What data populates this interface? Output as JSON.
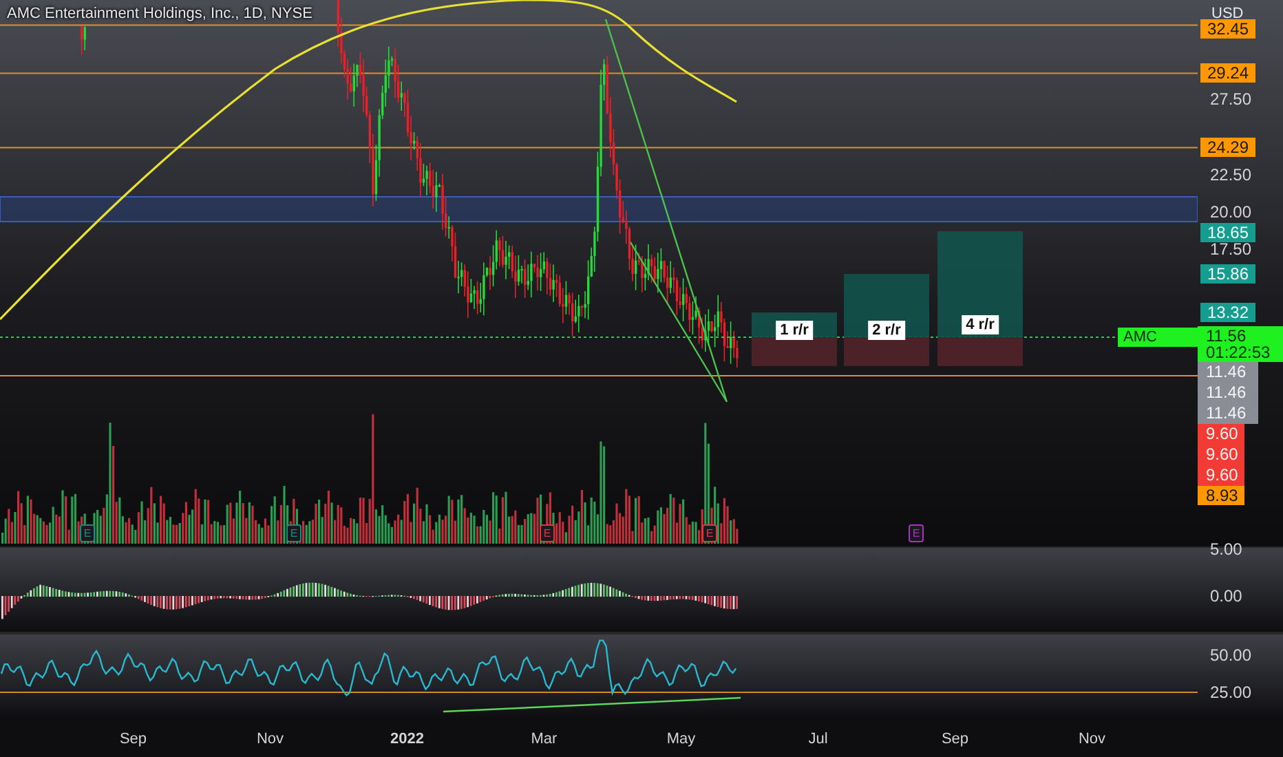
{
  "header": {
    "title": "AMC Entertainment Holdings, Inc., 1D, NYSE",
    "currency": "USD"
  },
  "price_axis": {
    "ticks": [
      "27.50",
      "22.50",
      "20.00",
      "17.50"
    ]
  },
  "price_tags": [
    {
      "text": "32.45",
      "color": "#ff9800"
    },
    {
      "text": "29.24",
      "color": "#ff9800"
    },
    {
      "text": "24.29",
      "color": "#ff9800"
    },
    {
      "text": "18.65",
      "color": "#159d8f"
    },
    {
      "text": "15.86",
      "color": "#159d8f"
    },
    {
      "text": "13.32",
      "color": "#159d8f"
    }
  ],
  "last_price": {
    "symbol": "AMC",
    "price": "11.56",
    "countdown": "01:22:53"
  },
  "stacked_tags": [
    {
      "text": "11.46",
      "color": "#8a8d96"
    },
    {
      "text": "11.46",
      "color": "#8a8d96"
    },
    {
      "text": "11.46",
      "color": "#8a8d96"
    },
    {
      "text": "9.60",
      "color": "#f23b34"
    },
    {
      "text": "9.60",
      "color": "#f23b34"
    },
    {
      "text": "9.60",
      "color": "#f23b34"
    },
    {
      "text": "8.93",
      "color": "#ff9800"
    }
  ],
  "risk_reward": [
    {
      "label": "1 r/r"
    },
    {
      "label": "2 r/r"
    },
    {
      "label": "4 r/r"
    }
  ],
  "earnings": [
    {
      "text": "E",
      "color": "#1a8a80"
    },
    {
      "text": "E",
      "color": "#1a8a80"
    },
    {
      "text": "E",
      "color": "#e0373b"
    },
    {
      "text": "E",
      "color": "#e0373b"
    },
    {
      "text": "E",
      "color": "#b02cc9"
    }
  ],
  "macd_axis": {
    "ticks": [
      "5.00",
      "0.00"
    ]
  },
  "rsi_axis": {
    "ticks": [
      "50.00",
      "25.00"
    ]
  },
  "time_axis": [
    {
      "text": "Sep",
      "kind": "month"
    },
    {
      "text": "Nov",
      "kind": "month"
    },
    {
      "text": "2022",
      "kind": "year"
    },
    {
      "text": "Mar",
      "kind": "month"
    },
    {
      "text": "May",
      "kind": "month"
    },
    {
      "text": "Jul",
      "kind": "month"
    },
    {
      "text": "Sep",
      "kind": "month"
    },
    {
      "text": "Nov",
      "kind": "month"
    }
  ]
}
